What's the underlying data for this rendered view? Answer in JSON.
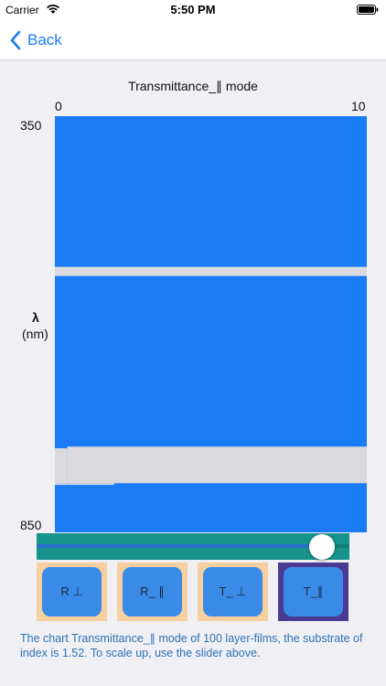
{
  "status_bar": {
    "carrier": "Carrier",
    "time": "5:50 PM"
  },
  "nav": {
    "back_label": "Back"
  },
  "chart_data": {
    "type": "heatmap",
    "title": "Transmittance_∥ mode",
    "x_ticks": [
      "0",
      "10"
    ],
    "y_ticks": [
      "350",
      "850"
    ],
    "ylabel_line1": "λ",
    "ylabel_line2": "(nm)",
    "xlim": [
      0,
      10
    ],
    "ylim": [
      350,
      850
    ],
    "colors": {
      "low": "#1b7bf5",
      "high": "#d9d9de"
    },
    "bands": [
      {
        "x_start": 0.0,
        "x_end": 10.0,
        "wl_start": 531,
        "wl_end": 542
      },
      {
        "x_start": 0.0,
        "x_end": 0.4,
        "wl_start": 749,
        "wl_end": 791
      },
      {
        "x_start": 0.4,
        "x_end": 10.0,
        "wl_start": 747,
        "wl_end": 791
      },
      {
        "x_start": 0.0,
        "x_end": 1.9,
        "wl_start": 791,
        "wl_end": 793
      }
    ]
  },
  "slider": {
    "value": 0.95
  },
  "buttons": [
    {
      "label": "R ⊥",
      "selected": false
    },
    {
      "label": "R_ ∥",
      "selected": false
    },
    {
      "label": "T_ ⊥",
      "selected": false
    },
    {
      "label": "T_∥",
      "selected": true
    }
  ],
  "description": "The chart Transmittance_∥ mode of 100 layer-films, the substrate of index is 1.52. To scale up, use the slider above."
}
